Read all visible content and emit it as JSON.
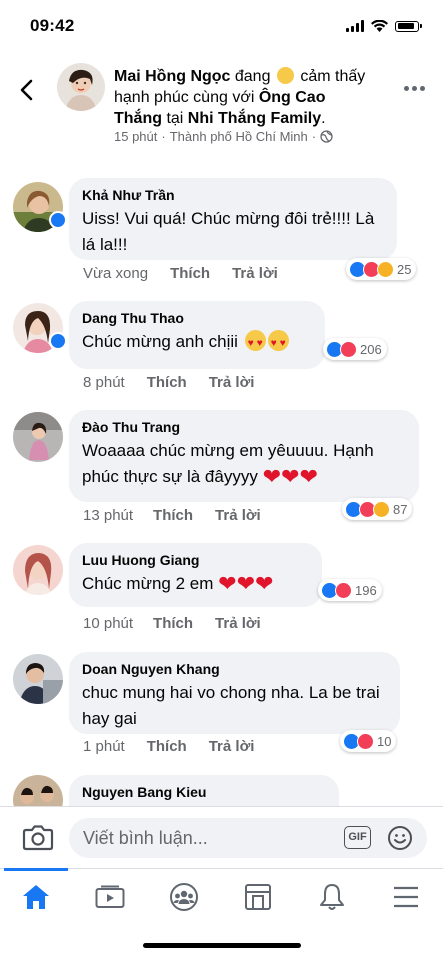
{
  "status": {
    "time": "09:42"
  },
  "post": {
    "author": "Mai Hồng Ngọc",
    "text_1": " đang ",
    "text_2": " cảm thấy hạnh phúc cùng với ",
    "with": "Ông Cao Thắng",
    "text_3": " tại ",
    "place": "Nhi Thắng Family",
    "text_4": ".",
    "time": "15 phút",
    "separator": "·",
    "location": "Thành phố Hồ Chí Minh",
    "separator2": "·"
  },
  "comments": [
    {
      "name": "Khả Như Trần",
      "text": "Uiss! Vui quá! Chúc mừng đôi trẻ!!!! Là lá la!!!",
      "time": "Vừa xong",
      "like": "Thích",
      "reply": "Trả lời",
      "reaction_count": "25",
      "reactions": [
        "like",
        "love",
        "haha"
      ],
      "verified": true
    },
    {
      "name": "Dang Thu Thao",
      "text": "Chúc mừng anh chịii",
      "time": "8 phút",
      "like": "Thích",
      "reply": "Trả lời",
      "reaction_count": "206",
      "reactions": [
        "like",
        "love"
      ],
      "verified": true
    },
    {
      "name": "Đào Thu Trang",
      "text": "Woaaaa chúc mừng em yêuuuu. Hạnh phúc thực sự là đâyyyy",
      "time": "13 phút",
      "like": "Thích",
      "reply": "Trả lời",
      "reaction_count": "87",
      "reactions": [
        "like",
        "love",
        "haha"
      ],
      "verified": false
    },
    {
      "name": "Luu Huong Giang",
      "text": "Chúc mừng 2 em",
      "time": "10 phút",
      "like": "Thích",
      "reply": "Trả lời",
      "reaction_count": "196",
      "reactions": [
        "like",
        "love"
      ],
      "verified": false
    },
    {
      "name": "Doan Nguyen Khang",
      "text": "chuc mung hai vo chong nha. La be trai hay gai",
      "time": "1 phút",
      "like": "Thích",
      "reply": "Trả lời",
      "reaction_count": "10",
      "reactions": [
        "like",
        "love"
      ],
      "verified": false
    },
    {
      "name": "Nguyen Bang Kieu"
    }
  ],
  "composer": {
    "placeholder": "Viết bình luận...",
    "gif_label": "GIF"
  },
  "tabs": [
    "home",
    "watch",
    "groups",
    "marketplace",
    "notifications",
    "menu"
  ],
  "colors": {
    "accent": "#1877f2",
    "bubble": "#f0f2f5",
    "love": "#f33e58",
    "haha": "#f7b125"
  }
}
